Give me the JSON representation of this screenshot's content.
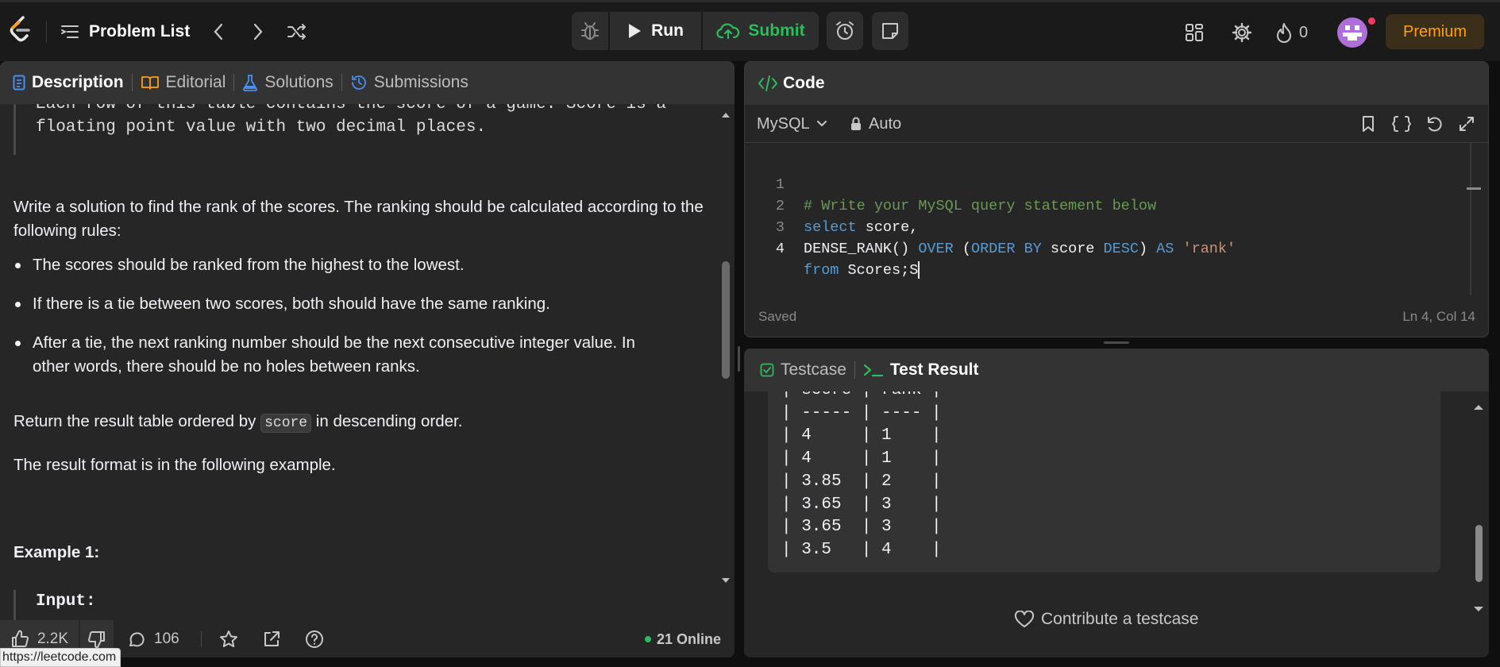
{
  "topbar": {
    "problem_list": "Problem List",
    "run": "Run",
    "submit": "Submit",
    "streak_count": "0",
    "premium": "Premium"
  },
  "left_tabs": {
    "description": "Description",
    "editorial": "Editorial",
    "solutions": "Solutions",
    "submissions": "Submissions"
  },
  "description": {
    "code_note_line1": "Each row of this table contains the score of a game. Score is a",
    "code_note_line2": "floating point value with two decimal places.",
    "intro": "Write a solution to find the rank of the scores. The ranking should be calculated according to the following rules:",
    "rules": [
      "The scores should be ranked from the highest to the lowest.",
      "If there is a tie between two scores, both should have the same ranking.",
      "After a tie, the next ranking number should be the next consecutive integer value. In other words, there should be no holes between ranks."
    ],
    "return_pre": "Return the result table ordered by ",
    "return_code": "score",
    "return_post": " in descending order.",
    "format": "The result format is in the following example.",
    "example_title": "Example 1:",
    "input_label": "Input:"
  },
  "left_footer": {
    "likes": "2.2K",
    "comments": "106",
    "online": "21 Online"
  },
  "status_url": "https://leetcode.com",
  "code_panel": {
    "title": "Code",
    "language": "MySQL",
    "mode": "Auto",
    "saved": "Saved",
    "cursor": "Ln 4, Col 14",
    "line_numbers": [
      "1",
      "2",
      "3",
      "4"
    ]
  },
  "code": {
    "l1_comment": "# Write your MySQL query statement below",
    "l2_kw": "select",
    "l2_rest": " score,",
    "l3_a": "DENSE_RANK() ",
    "l3_over": "OVER",
    "l3_b": " (",
    "l3_order": "ORDER BY",
    "l3_c": " score ",
    "l3_desc": "DESC",
    "l3_d": ") ",
    "l3_as": "AS",
    "l3_e": " ",
    "l3_str": "'rank'",
    "l4_kw": "from",
    "l4_rest": " Scores;S"
  },
  "result_panel": {
    "testcase": "Testcase",
    "test_result": "Test Result",
    "rows": [
      "| score | rank |",
      "| ----- | ---- |",
      "| 4     | 1    |",
      "| 4     | 1    |",
      "| 3.85  | 2    |",
      "| 3.65  | 3    |",
      "| 3.65  | 3    |",
      "| 3.5   | 4    |"
    ],
    "contribute": "Contribute a testcase"
  },
  "colors": {
    "run_bg": "#2d2d2d",
    "submit_green": "#2cbb5d",
    "premium_orange": "#ffa116",
    "accent_blue": "#4a8ff0",
    "online_green": "#2cbb5d"
  }
}
